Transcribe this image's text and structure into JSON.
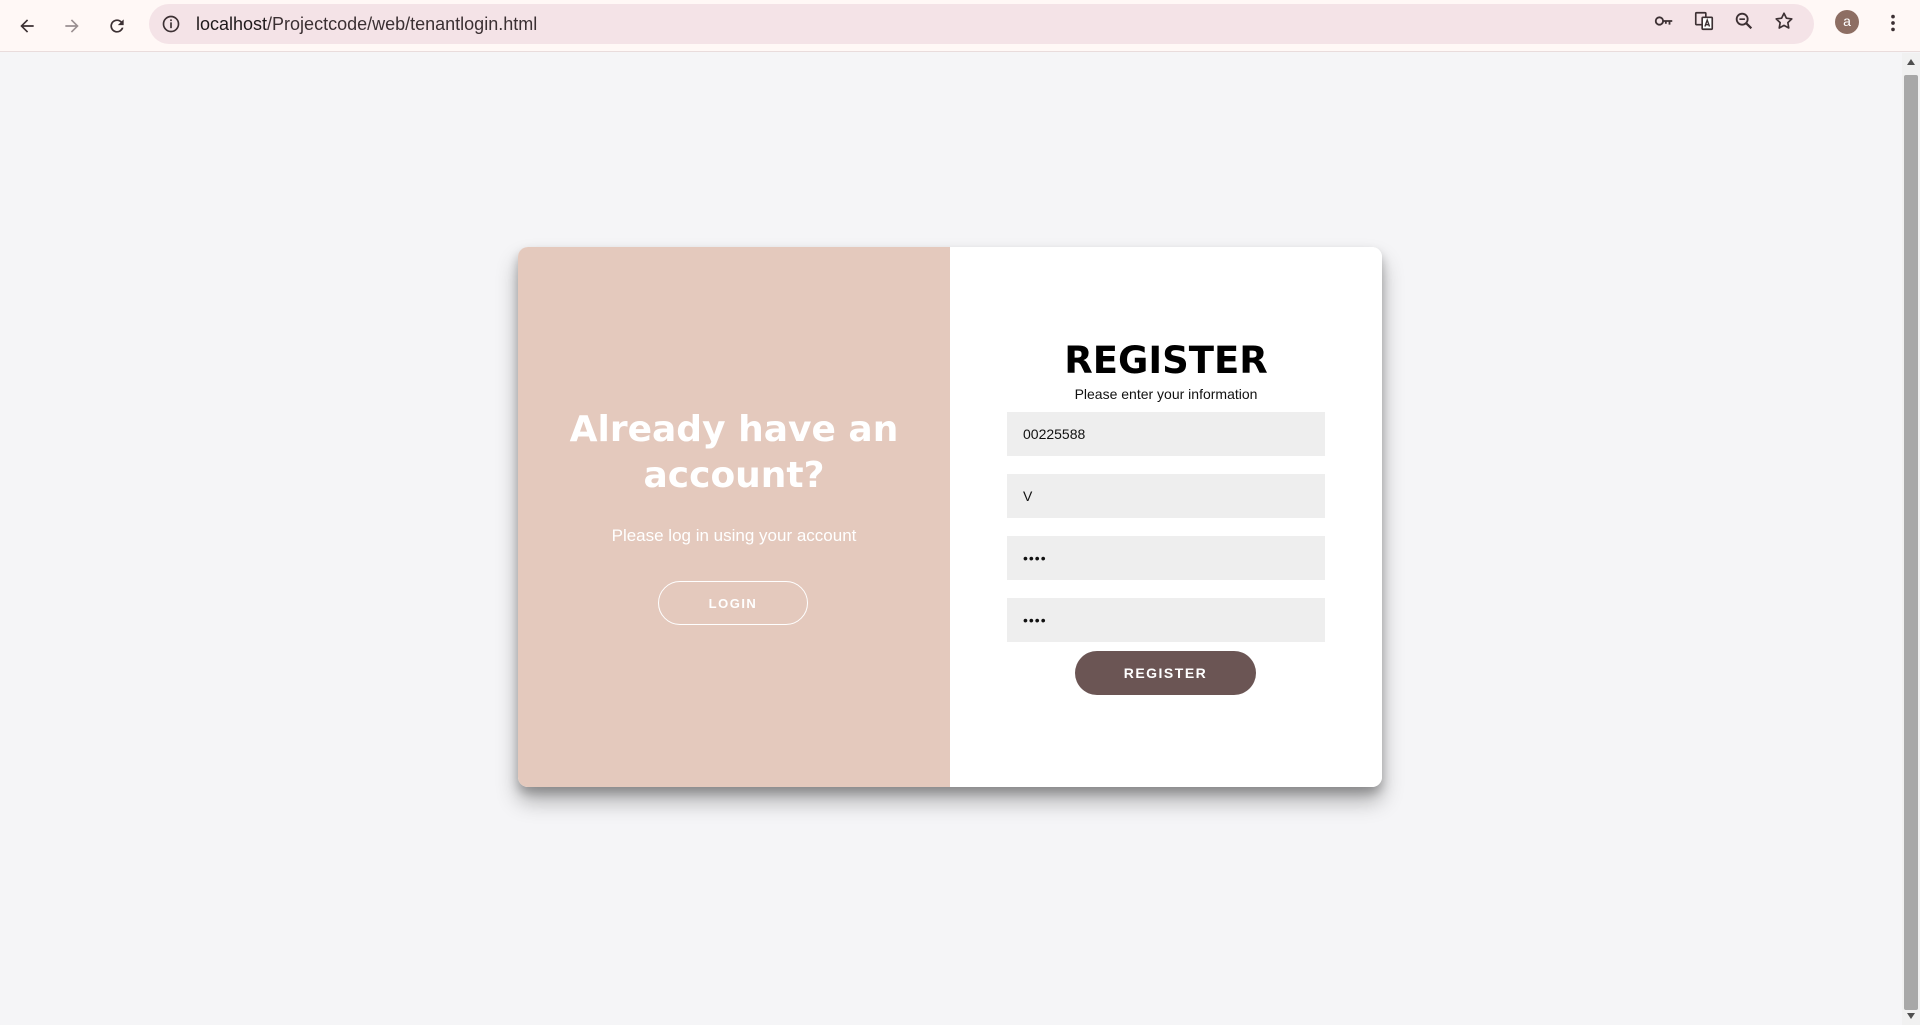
{
  "browser": {
    "url_host": "localhost",
    "url_path": "/Projectcode/web/tenantlogin.html",
    "profile_initial": "a",
    "icons": {
      "back": "back-arrow-icon",
      "forward": "forward-arrow-icon",
      "reload": "reload-icon",
      "site_info": "info-icon",
      "passwords": "key-icon",
      "translate": "translate-icon",
      "zoom": "zoom-icon",
      "bookmark": "star-icon",
      "menu": "kebab-menu-icon"
    }
  },
  "left_panel": {
    "heading": "Already have an account?",
    "text": "Please log in using your account",
    "login_label": "LOGIN"
  },
  "register_form": {
    "title": "REGISTER",
    "subtitle": "Please enter your information",
    "fields": [
      {
        "value": "00225588",
        "type": "text"
      },
      {
        "value": "V",
        "type": "text"
      },
      {
        "value": "••••",
        "type": "password"
      },
      {
        "value": "••••",
        "type": "password"
      }
    ],
    "submit_label": "REGISTER"
  },
  "colors": {
    "left_panel_bg": "#e4c9bd",
    "register_button_bg": "#6b5554",
    "page_bg": "#f5f5f7",
    "input_bg": "#eeeeee"
  }
}
